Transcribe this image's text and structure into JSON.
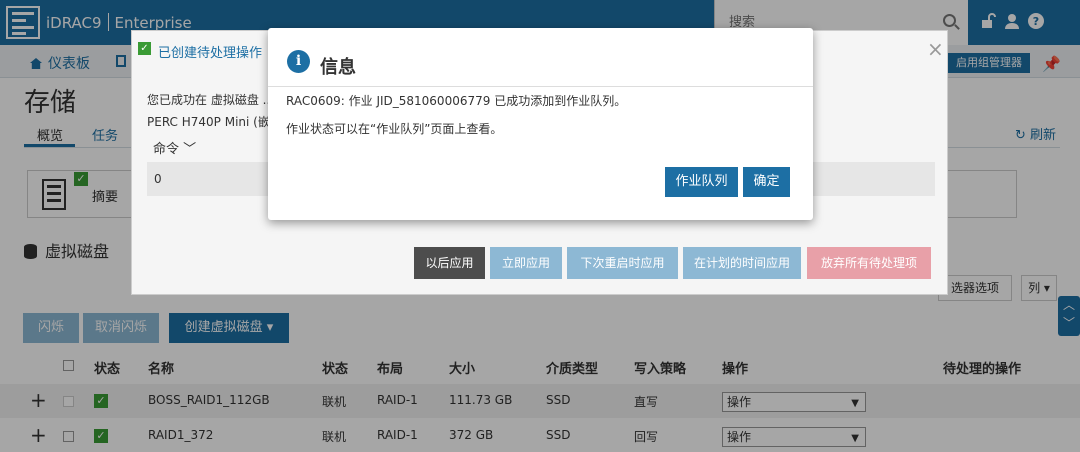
{
  "header": {
    "brand": "iDRAC9",
    "edition": "Enterprise",
    "search_placeholder": "搜索"
  },
  "nav": {
    "home_label": "仪表板",
    "group_manager_label": "启用组管理器"
  },
  "page": {
    "title": "存储",
    "tabs": [
      {
        "label": "概览",
        "active": true
      },
      {
        "label": "任务",
        "active": false
      }
    ],
    "refresh_label": "刷新",
    "summary_label": "摘要",
    "section_title": "虚拟磁盘",
    "filter_label": "选器选项",
    "columns_label": "列",
    "toolbar": {
      "blink": "闪烁",
      "unblink": "取消闪烁",
      "create": "创建虚拟磁盘"
    },
    "table": {
      "headers": [
        "状态",
        "名称",
        "状态",
        "布局",
        "大小",
        "介质类型",
        "写入策略",
        "操作",
        "待处理的操作"
      ],
      "rows": [
        {
          "name": "BOSS_RAID1_112GB",
          "state": "联机",
          "layout": "RAID-1",
          "size": "111.73 GB",
          "media": "SSD",
          "write_policy": "直写",
          "action": "操作"
        },
        {
          "name": "RAID1_372",
          "state": "联机",
          "layout": "RAID-1",
          "size": "372 GB",
          "media": "SSD",
          "write_policy": "回写",
          "action": "操作"
        }
      ]
    }
  },
  "pending_modal": {
    "title": "已创建待处理操作",
    "text1": "您已成功在 虚拟磁盘 ...",
    "text2": "PERC H740P Mini (嵌入...",
    "command_label": "命令",
    "buttons": [
      "以后应用",
      "立即应用",
      "下次重启时应用",
      "在计划的时间应用",
      "放弃所有待处理项"
    ]
  },
  "info_modal": {
    "title": "信息",
    "message1": "RAC0609: 作业 JID_581060006779 已成功添加到作业队列。",
    "message2": "作业状态可以在“作业队列”页面上查看。",
    "job_queue_button": "作业队列",
    "ok_button": "确定"
  },
  "colors": {
    "primary": "#1d6fa4",
    "success": "#3a9b35",
    "disabled": "#8db8d4"
  }
}
